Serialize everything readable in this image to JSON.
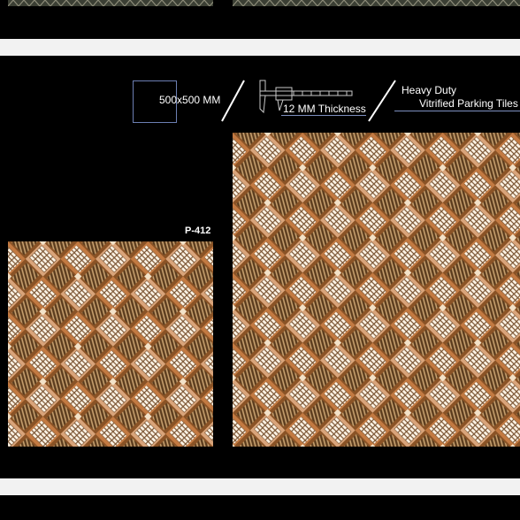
{
  "colors": {
    "background": "#000000",
    "separator": "#f2f2f2",
    "accent_line": "#7d8fbf"
  },
  "spec": {
    "size_label": "500x500 MM",
    "thickness_label": "12 MM Thickness",
    "duty_line1": "Heavy Duty",
    "duty_line2": "Vitrified Parking Tiles"
  },
  "product": {
    "code": "P-412"
  },
  "icons": {
    "size": "square-outline-icon",
    "thickness": "caliper-icon"
  }
}
